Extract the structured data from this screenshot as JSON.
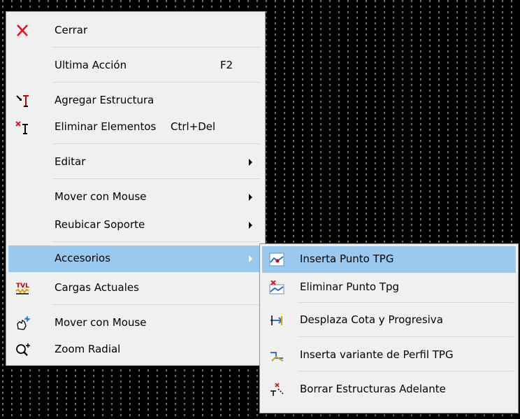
{
  "main_menu": {
    "items": [
      {
        "label": "Cerrar",
        "icon": "close-icon"
      },
      {
        "label": "Ultima Acción",
        "shortcut": "F2"
      },
      {
        "label": "Agregar Estructura",
        "icon": "add-structure-icon"
      },
      {
        "label": "Eliminar Elementos",
        "shortcut": "Ctrl+Del",
        "icon": "delete-elements-icon"
      },
      {
        "label": "Editar",
        "submenu": true
      },
      {
        "label": "Mover con Mouse",
        "submenu": true
      },
      {
        "label": "Reubicar Soporte",
        "submenu": true
      },
      {
        "label": "Accesorios",
        "submenu": true,
        "highlighted": true
      },
      {
        "label": "Cargas Actuales",
        "icon": "loads-icon"
      },
      {
        "label": "Mover con Mouse",
        "icon": "hand-move-icon"
      },
      {
        "label": "Zoom Radial",
        "icon": "zoom-icon"
      }
    ]
  },
  "sub_menu": {
    "items": [
      {
        "label": "Inserta Punto TPG",
        "icon": "insert-point-icon",
        "highlighted": true
      },
      {
        "label": "Eliminar Punto Tpg",
        "icon": "delete-point-icon"
      },
      {
        "label": "Desplaza Cota y Progresiva",
        "icon": "shift-elevation-icon"
      },
      {
        "label": "Inserta variante de Perfil TPG",
        "icon": "insert-variant-icon"
      },
      {
        "label": "Borrar Estructuras Adelante",
        "icon": "delete-forward-icon"
      }
    ]
  },
  "colors": {
    "highlight": "#99c9ef",
    "menu_bg": "#f0f0f0",
    "canvas_bg": "#000000",
    "close_icon": "#e81123"
  }
}
